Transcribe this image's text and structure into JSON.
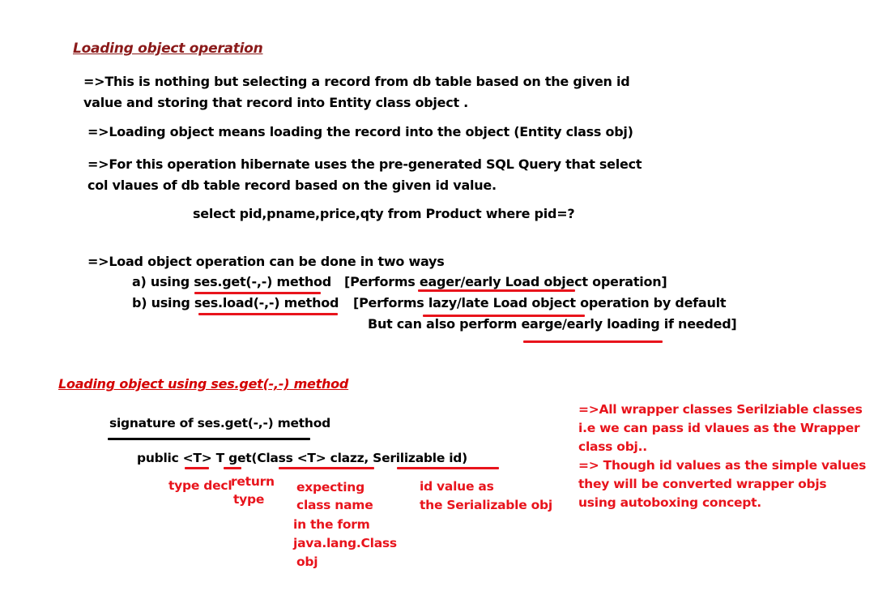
{
  "section1": {
    "heading": "Loading object operation",
    "p1": {
      "line1": "=>This is nothing but selecting a record from db table based on the given id",
      "line2": "value   and storing that record  into Entity class object ."
    },
    "p2": "=>Loading  object  means loading the record into the object (Entity class obj)",
    "p3": {
      "line1": "=>For this  operation hibernate uses  the pre-generated SQL Query that select",
      "line2": "col  vlaues of db table record based on the given id value."
    },
    "query": "select pid,pname,price,qty from Product where pid=?",
    "ways": {
      "intro": "=>Load object operation can be done in two ways",
      "a_text": "a)  using ses.get(-,-) method",
      "a_note": "[Performs eager/early Load object operation]",
      "b_text": "b)  using ses.load(-,-) method",
      "b_note": "[Performs lazy/late Load object operation by default",
      "b_note2": "But can also perform  earge/early loading if needed]"
    }
  },
  "section2": {
    "heading": "Loading object using  ses.get(-,-) method",
    "signature_label": "signature of ses.get(-,-) method",
    "signature_code": "public  <T>   T   get(Class <T>  clazz,  Serilizable id)",
    "annotations": {
      "type_decl": "type decl",
      "return_type_1": "return",
      "return_type_2": "type",
      "expecting_1": "expecting",
      "expecting_2": "class name",
      "expecting_3": "in the form",
      "expecting_4": "java.lang.Class",
      "expecting_5": "obj",
      "id_value_1": "id value as",
      "id_value_2": "the Serializable obj"
    },
    "side_note": {
      "line1": "=>All wrapper classes Serilziable classes",
      "line2": "i.e we can pass id vlaues as the Wrapper",
      "line3": "class obj..",
      "line4": "=> Though  id values as the simple values",
      "line5": "they will be converted wrapper objs",
      "line6": "using  autoboxing concept."
    }
  },
  "colors": {
    "heading_dark_red": "#8b1a1a",
    "annotation_red": "#e8141c",
    "text": "#000000"
  }
}
